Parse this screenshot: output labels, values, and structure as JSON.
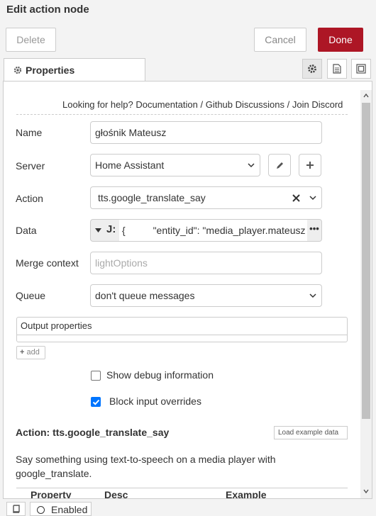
{
  "header": {
    "title": "Edit action node"
  },
  "toolbar": {
    "delete_label": "Delete",
    "cancel_label": "Cancel",
    "done_label": "Done"
  },
  "tabs": {
    "properties_label": "Properties"
  },
  "help": {
    "prefix": "Looking for help?",
    "documentation": "Documentation",
    "github": "Github Discussions",
    "discord": "Join Discord",
    "sep": "/"
  },
  "form": {
    "name_label": "Name",
    "name_value": "głośnik Mateusz",
    "server_label": "Server",
    "server_value": "Home Assistant",
    "action_label": "Action",
    "action_value": "tts.google_translate_say",
    "data_label": "Data",
    "data_value": "{          \"entity_id\": \"media_player.mateusz",
    "merge_label": "Merge context",
    "merge_placeholder": "lightOptions",
    "queue_label": "Queue",
    "queue_value": "don't queue messages",
    "output_label": "Output properties",
    "add_label": "add",
    "debug_label": "Show debug information",
    "debug_checked": false,
    "block_label": "Block input overrides",
    "block_checked": true
  },
  "docs": {
    "title": "Action: tts.google_translate_say",
    "load_example": "Load example data",
    "description": "Say something using text-to-speech on a media player with google_translate.",
    "columns": [
      "Property",
      "Desc",
      "Example"
    ]
  },
  "footer": {
    "enabled_label": "Enabled"
  },
  "colors": {
    "primary": "#ad1625",
    "checkbox": "#0075ff",
    "border": "#cccccc"
  }
}
